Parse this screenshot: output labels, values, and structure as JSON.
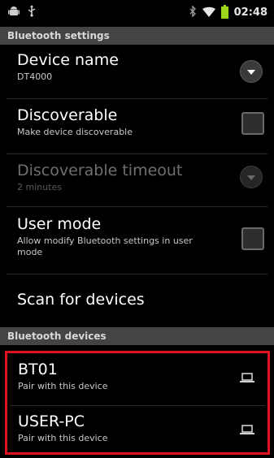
{
  "status_bar": {
    "icons": [
      "android-icon",
      "usb-icon",
      "bluetooth-icon",
      "wifi-icon",
      "battery-icon"
    ],
    "time": "02:48"
  },
  "bluetooth_settings": {
    "header": "Bluetooth settings",
    "items": [
      {
        "title": "Device name",
        "summary": "DT4000",
        "widget": "dropdown",
        "enabled": true
      },
      {
        "title": "Discoverable",
        "summary": "Make device discoverable",
        "widget": "checkbox",
        "checked": false,
        "enabled": true
      },
      {
        "title": "Discoverable timeout",
        "summary": "2 minutes",
        "widget": "dropdown",
        "enabled": false
      },
      {
        "title": "User mode",
        "summary": "Allow modify Bluetooth settings in user mode",
        "widget": "checkbox",
        "checked": false,
        "enabled": true
      },
      {
        "title": "Scan for devices",
        "enabled": true
      }
    ]
  },
  "bluetooth_devices": {
    "header": "Bluetooth devices",
    "devices": [
      {
        "name": "BT01",
        "summary": "Pair with this device",
        "icon": "laptop-icon"
      },
      {
        "name": "USER-PC",
        "summary": "Pair with this device",
        "icon": "laptop-icon"
      }
    ]
  },
  "colors": {
    "highlight_border": "#e0141e",
    "battery": "#9bd41a",
    "section_header_bg": "#424542"
  }
}
